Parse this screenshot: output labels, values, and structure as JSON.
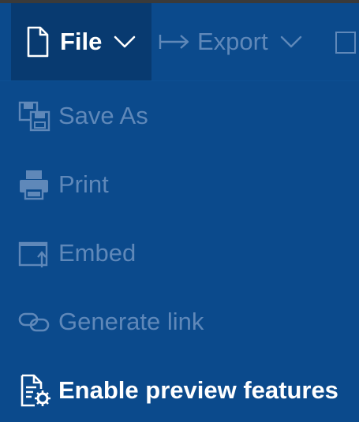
{
  "menubar": {
    "file": {
      "label": "File",
      "icon": "document-icon",
      "chevron": "chevron-down-icon"
    },
    "export": {
      "label": "Export",
      "icon": "arrow-right-bar-icon",
      "chevron": "chevron-down-icon"
    },
    "next_icon": "box-icon"
  },
  "dropdown": {
    "items": [
      {
        "label": "Save As",
        "icon": "save-as-icon",
        "enabled": false
      },
      {
        "label": "Print",
        "icon": "printer-icon",
        "enabled": false
      },
      {
        "label": "Embed",
        "icon": "embed-icon",
        "enabled": false
      },
      {
        "label": "Generate link",
        "icon": "link-icon",
        "enabled": false
      },
      {
        "label": "Enable preview features",
        "icon": "preview-features-icon",
        "enabled": true
      }
    ]
  },
  "colors": {
    "background": "#0b4a8c",
    "file_menu_active": "#083a70",
    "disabled_text": "#5f88b9",
    "enabled_text": "#ffffff"
  }
}
